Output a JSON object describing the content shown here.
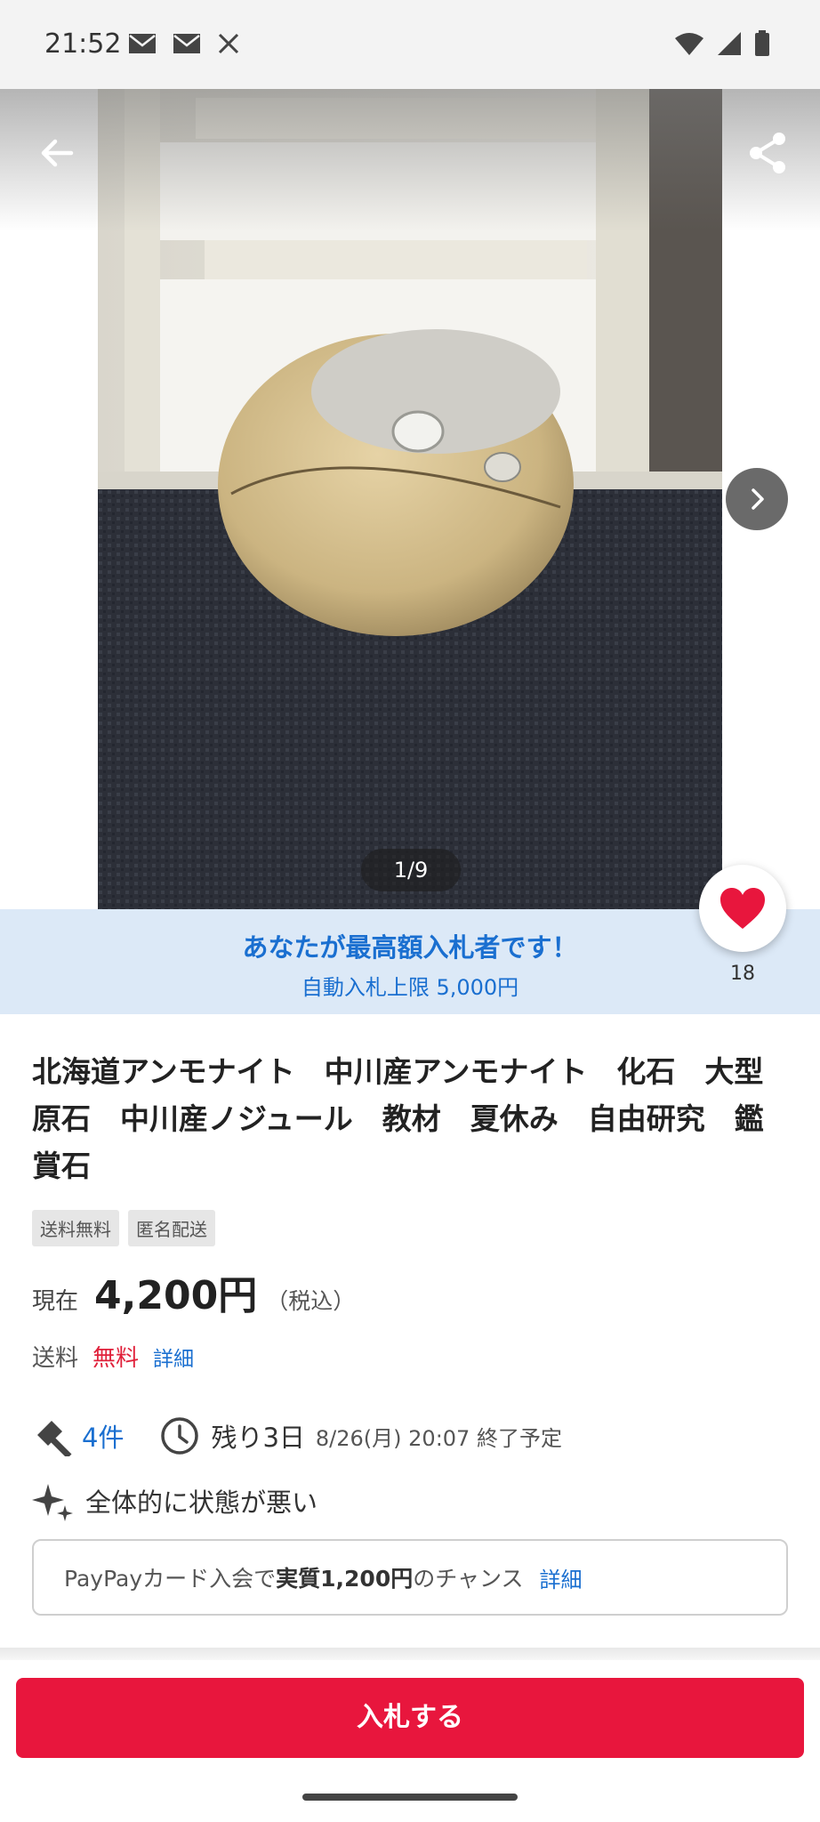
{
  "status_bar": {
    "time": "21:52",
    "left_icons": [
      "mail-icon",
      "mail-icon",
      "x-icon"
    ],
    "right_icons": [
      "wifi-icon",
      "signal-icon",
      "battery-icon"
    ]
  },
  "gallery": {
    "page_counter": "1/9",
    "current_index": 1,
    "total": 9
  },
  "bidder_banner": {
    "title": "あなたが最高額入札者です！",
    "subtitle": "自動入札上限 5,000円"
  },
  "favorite": {
    "count": "18"
  },
  "item": {
    "title": "北海道アンモナイト　中川産アンモナイト　化石　大型原石　中川産ノジュール　教材　夏休み　自由研究　鑑賞石",
    "tags": [
      "送料無料",
      "匿名配送"
    ]
  },
  "price": {
    "label": "現在",
    "value": "4,200円",
    "tax": "（税込）"
  },
  "shipping": {
    "label": "送料",
    "value": "無料",
    "detail_link": "詳細"
  },
  "auction": {
    "bids": "4件",
    "remaining": "残り3日",
    "end_date": "8/26(月) 20:07 終了予定"
  },
  "condition": {
    "text": "全体的に状態が悪い"
  },
  "promo": {
    "prefix": "PayPayカード入会で",
    "strong": "実質1,200円",
    "suffix": "のチャンス",
    "detail_link": "詳細"
  },
  "actions": {
    "bid_button": "入札する"
  },
  "colors": {
    "accent_blue": "#1a6fd0",
    "accent_red": "#e8163d",
    "banner_bg": "#dce9f7"
  }
}
